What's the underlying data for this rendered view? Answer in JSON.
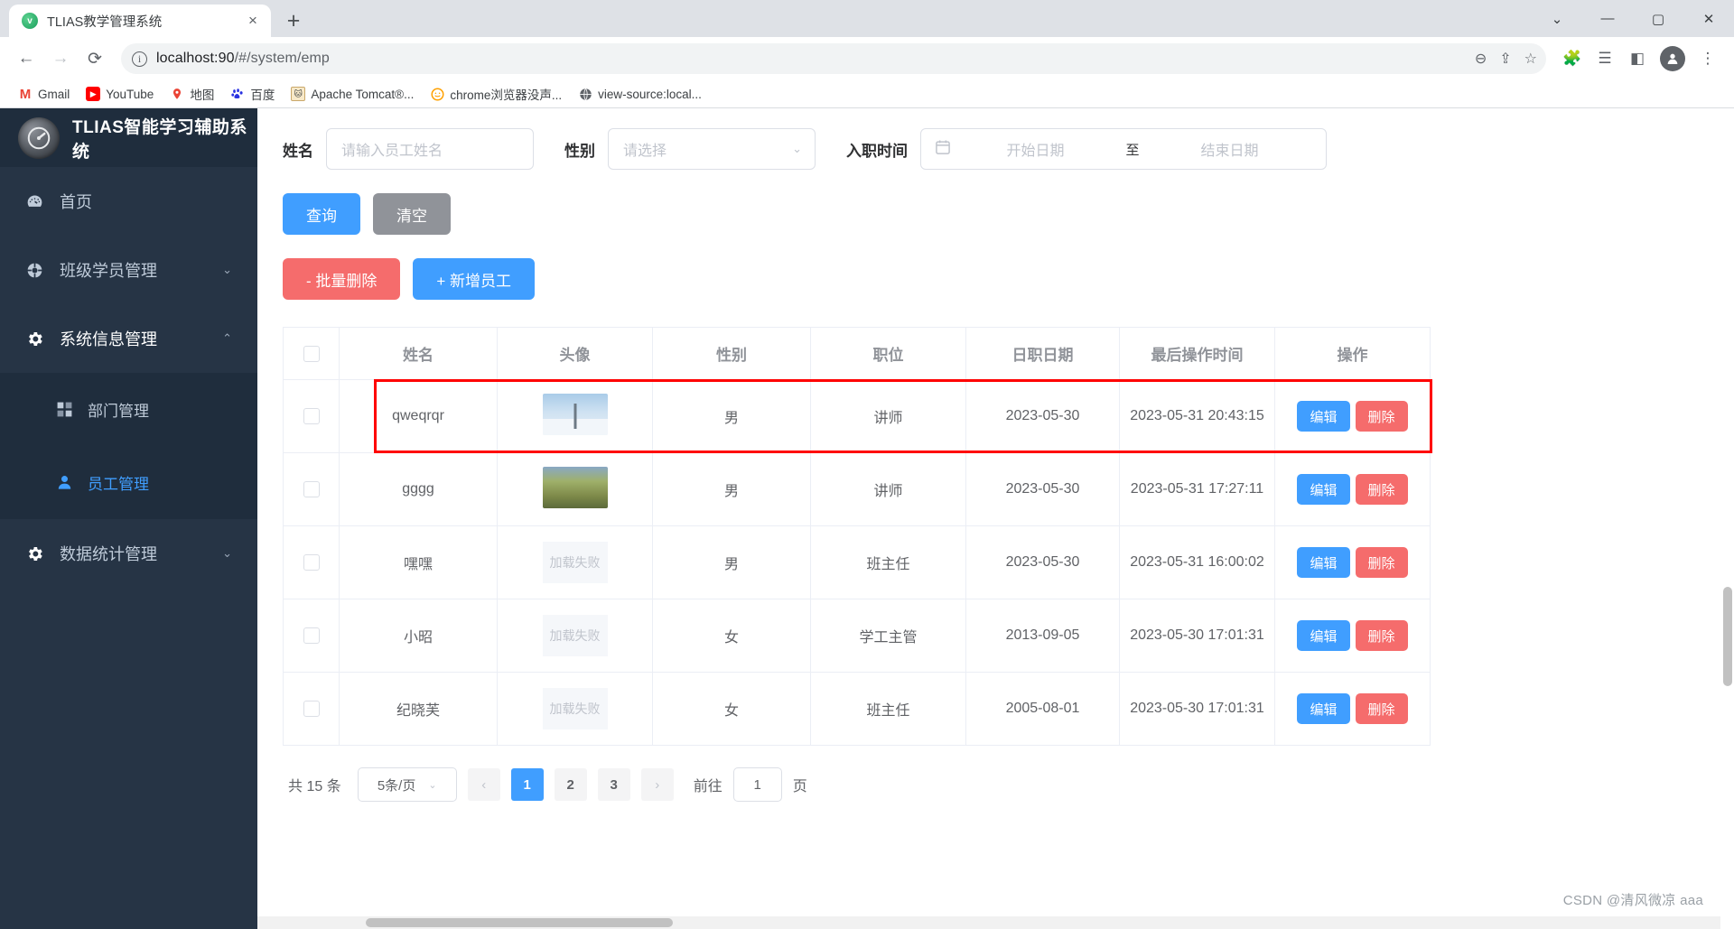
{
  "browser": {
    "tab": {
      "title": "TLIAS教学管理系统",
      "favicon": "v-favicon-icon",
      "close": "×"
    },
    "newtab_label": "+",
    "window_controls": {
      "dropdown": "⌄",
      "minimize": "—",
      "maximize": "▢",
      "close": "✕"
    },
    "nav": {
      "back": "←",
      "forward": "→",
      "reload": "⟳"
    },
    "omnibox": {
      "info_icon": "ⓘ",
      "url_host": "localhost:90",
      "url_path": "/#/system/emp",
      "zoom_icon": "⊖",
      "share_icon": "⇪",
      "star_icon": "☆"
    },
    "toolbar_icons": {
      "extensions": "🧩",
      "reading_list": "☰",
      "side_panel": "◧",
      "profile": "👤",
      "menu": "⋮"
    },
    "bookmarks": [
      {
        "label": "Gmail",
        "icon": "gmail-icon",
        "glyph": "M"
      },
      {
        "label": "YouTube",
        "icon": "youtube-icon",
        "glyph": "▶"
      },
      {
        "label": "地图",
        "icon": "google-maps-icon",
        "glyph": "📍"
      },
      {
        "label": "百度",
        "icon": "baidu-icon",
        "glyph": "🐾"
      },
      {
        "label": "Apache Tomcat®...",
        "icon": "tomcat-icon",
        "glyph": "🐱"
      },
      {
        "label": "chrome浏览器没声...",
        "icon": "chrome-sound-icon",
        "glyph": "☺"
      },
      {
        "label": "view-source:local...",
        "icon": "globe-icon",
        "glyph": "🌐"
      }
    ]
  },
  "sidebar": {
    "logo_text": "TLIAS智能学习辅助系统",
    "items": [
      {
        "label": "首页",
        "icon": "dashboard-icon",
        "arrow": ""
      },
      {
        "label": "班级学员管理",
        "icon": "class-icon",
        "arrow": "⌄"
      },
      {
        "label": "系统信息管理",
        "icon": "gear-icon",
        "arrow": "⌃"
      },
      {
        "label": "数据统计管理",
        "icon": "gear-icon",
        "arrow": "⌄"
      }
    ],
    "submenu": [
      {
        "label": "部门管理",
        "icon": "grid-icon",
        "active": false
      },
      {
        "label": "员工管理",
        "icon": "user-icon",
        "active": true
      }
    ]
  },
  "filter": {
    "name_label": "姓名",
    "name_placeholder": "请输入员工姓名",
    "gender_label": "性别",
    "gender_placeholder": "请选择",
    "gender_chevron": "⌄",
    "date_label": "入职时间",
    "calendar_icon": "▤",
    "start_placeholder": "开始日期",
    "separator": "至",
    "end_placeholder": "结束日期"
  },
  "actions": {
    "search": "查询",
    "clear": "清空",
    "batch_delete": "- 批量删除",
    "add_employee": "+ 新增员工"
  },
  "table": {
    "headers": [
      "",
      "姓名",
      "头像",
      "性别",
      "职位",
      "日职日期",
      "最后操作时间",
      "操作"
    ],
    "rows": [
      {
        "name": "qweqrqr",
        "avatar": "image-snow-tree",
        "avatar_text": "",
        "gender": "男",
        "position": "讲师",
        "hire_date": "2023-05-30",
        "last_op": "2023-05-31 20:43:15",
        "edit": "编辑",
        "delete": "删除",
        "highlighted": true
      },
      {
        "name": "gggg",
        "avatar": "image-autumn-trees",
        "avatar_text": "",
        "gender": "男",
        "position": "讲师",
        "hire_date": "2023-05-30",
        "last_op": "2023-05-31 17:27:11",
        "edit": "编辑",
        "delete": "删除",
        "highlighted": false
      },
      {
        "name": "嘿嘿",
        "avatar": "image-load-failed",
        "avatar_text": "加载失败",
        "gender": "男",
        "position": "班主任",
        "hire_date": "2023-05-30",
        "last_op": "2023-05-31 16:00:02",
        "edit": "编辑",
        "delete": "删除",
        "highlighted": false
      },
      {
        "name": "小昭",
        "avatar": "image-load-failed",
        "avatar_text": "加载失败",
        "gender": "女",
        "position": "学工主管",
        "hire_date": "2013-09-05",
        "last_op": "2023-05-30 17:01:31",
        "edit": "编辑",
        "delete": "删除",
        "highlighted": false
      },
      {
        "name": "纪晓芙",
        "avatar": "image-load-failed",
        "avatar_text": "加载失败",
        "gender": "女",
        "position": "班主任",
        "hire_date": "2005-08-01",
        "last_op": "2023-05-30 17:01:31",
        "edit": "编辑",
        "delete": "删除",
        "highlighted": false
      }
    ]
  },
  "pagination": {
    "total": "共 15 条",
    "page_size": "5条/页",
    "page_size_chevron": "⌄",
    "prev": "‹",
    "pages": [
      "1",
      "2",
      "3"
    ],
    "current_page": "1",
    "next": "›",
    "goto_label": "前往",
    "goto_value": "1",
    "page_unit": "页"
  },
  "watermark": "CSDN @清风微凉 aaa",
  "colors": {
    "primary": "#409eff",
    "danger": "#f56c6c",
    "info": "#909399",
    "sidebar": "#263445",
    "sidebar_dark": "#1f2d3d",
    "highlight": "#ff0000"
  }
}
